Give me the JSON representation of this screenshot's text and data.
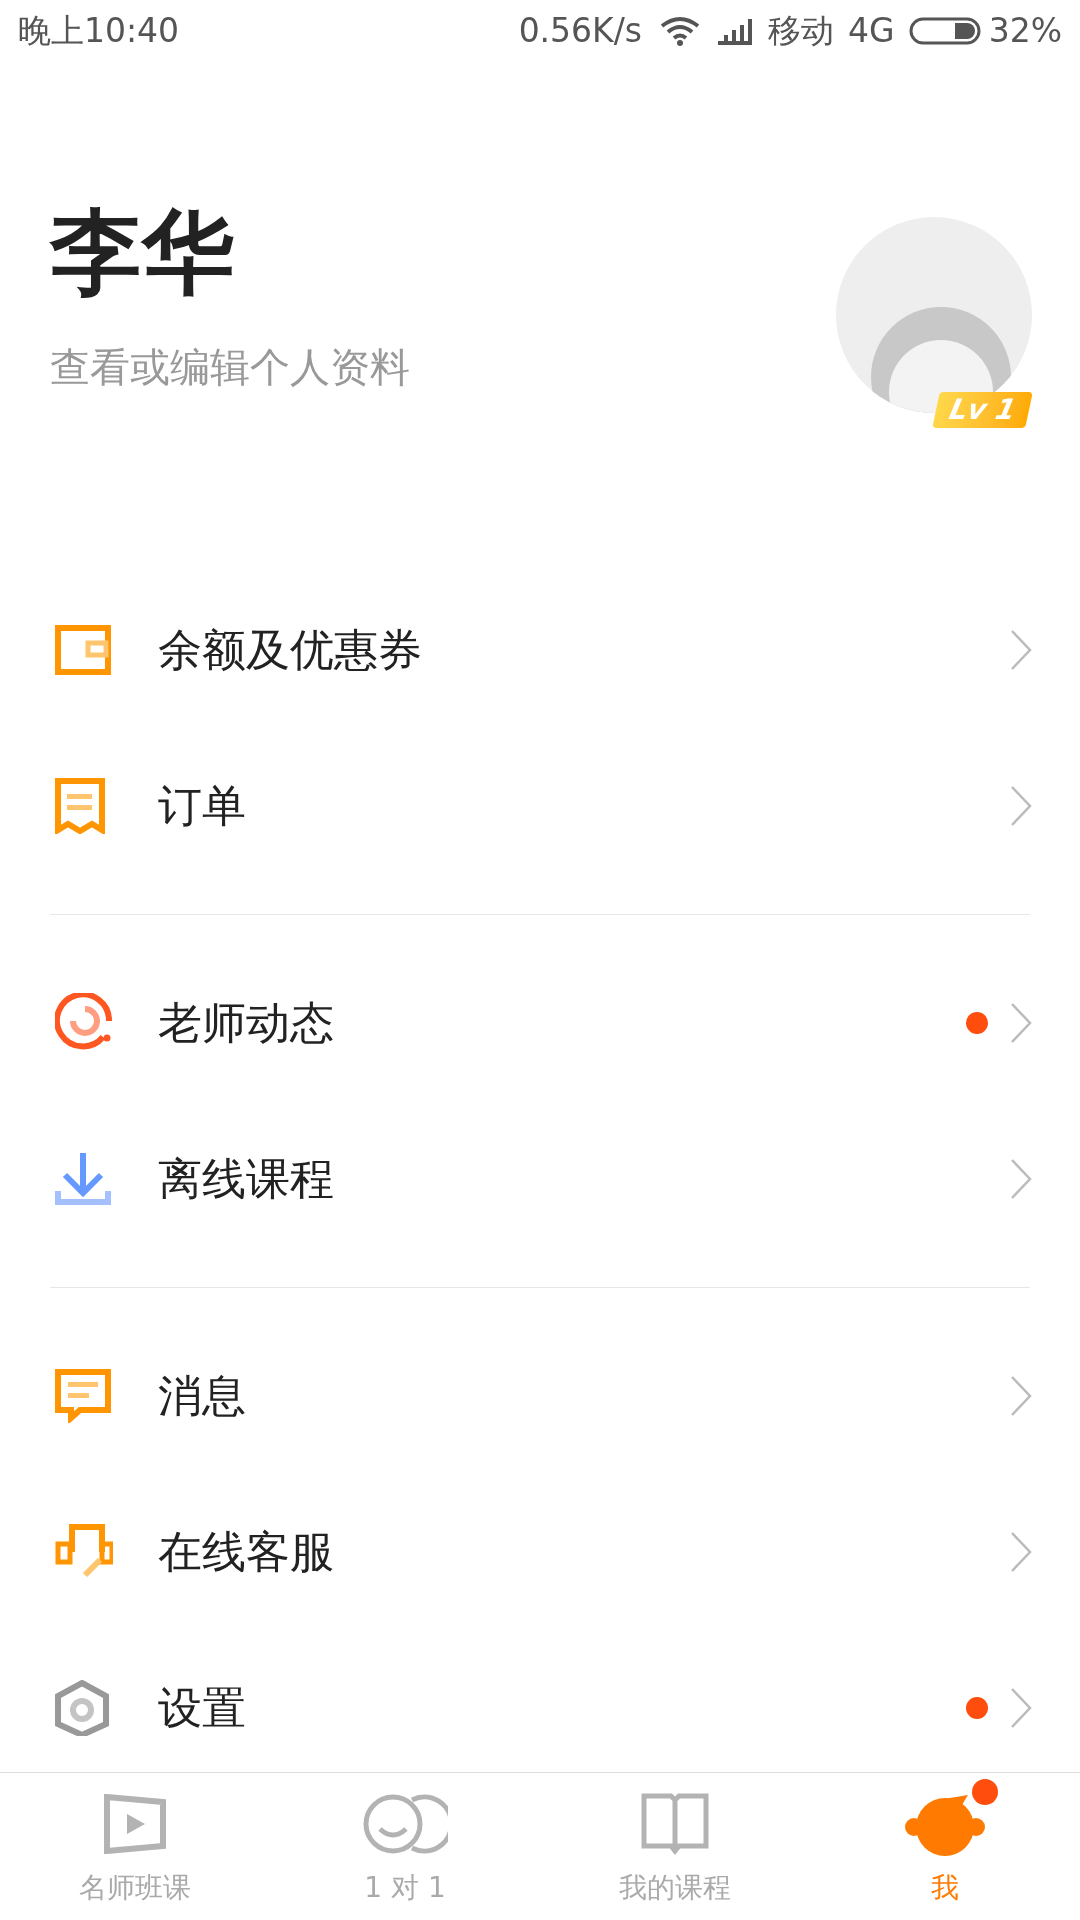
{
  "status_bar": {
    "time": "晚上10:40",
    "speed": "0.56K/s",
    "carrier": "移动",
    "network": "4G",
    "battery": "32%"
  },
  "profile": {
    "name": "李华",
    "subtitle": "查看或编辑个人资料",
    "level_badge": "Lv 1"
  },
  "menu_groups": [
    [
      {
        "label": "余额及优惠券",
        "dot": false
      },
      {
        "label": "订单",
        "dot": false
      }
    ],
    [
      {
        "label": "老师动态",
        "dot": true
      },
      {
        "label": "离线课程",
        "dot": false
      }
    ],
    [
      {
        "label": "消息",
        "dot": false
      },
      {
        "label": "在线客服",
        "dot": false
      },
      {
        "label": "设置",
        "dot": true
      }
    ]
  ],
  "tabs": [
    {
      "label": "名师班课",
      "selected": false,
      "dot": false
    },
    {
      "label": "1 对 1",
      "selected": false,
      "dot": false
    },
    {
      "label": "我的课程",
      "selected": false,
      "dot": false
    },
    {
      "label": "我",
      "selected": true,
      "dot": true
    }
  ]
}
